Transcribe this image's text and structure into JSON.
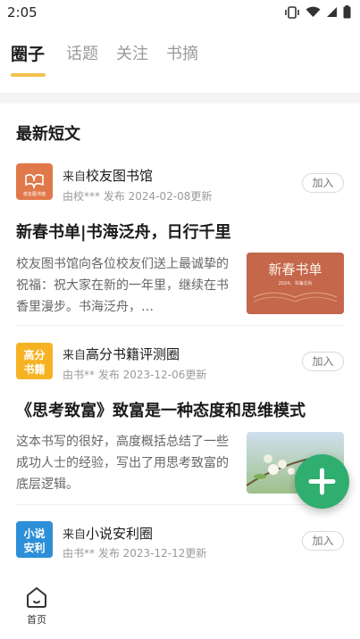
{
  "status_bar": {
    "time": "2:05"
  },
  "tabs": [
    {
      "label": "圈子",
      "active": true
    },
    {
      "label": "话题",
      "active": false
    },
    {
      "label": "关注",
      "active": false
    },
    {
      "label": "书摘",
      "active": false
    }
  ],
  "section": {
    "title": "最新短文"
  },
  "posts": [
    {
      "source_prefix": "来自",
      "source_name": "校友图书馆",
      "meta": "由校*** 发布   2024-02-08更新",
      "join_label": "加入",
      "title": "新春书单|书海泛舟，日行千里",
      "excerpt": "校友图书馆向各位校友们送上最诚挚的祝福：祝大家在新的一年里，继续在书香里漫步。书海泛舟，…",
      "avatar_text": "校友图书馆",
      "thumb_text": "新春书单",
      "thumb_subtext": "2024，书海泛舟"
    },
    {
      "source_prefix": "来自",
      "source_name": "高分书籍评测圈",
      "meta": "由书** 发布   2023-12-06更新",
      "join_label": "加入",
      "title": "《思考致富》致富是一种态度和思维模式",
      "excerpt": "这本书写的很好，高度概括总结了一些成功人士的经验，写出了用思考致富的底层逻辑。",
      "avatar_text_1": "高分",
      "avatar_text_2": "书籍"
    },
    {
      "source_prefix": "来自",
      "source_name": "小说安利圈",
      "meta": "由书** 发布   2023-12-12更新",
      "join_label": "加入",
      "avatar_text_1": "小说",
      "avatar_text_2": "安利"
    }
  ],
  "bottom_nav": {
    "home_label": "首页"
  },
  "colors": {
    "accent": "#f2c14e",
    "fab": "#2fae6f"
  }
}
